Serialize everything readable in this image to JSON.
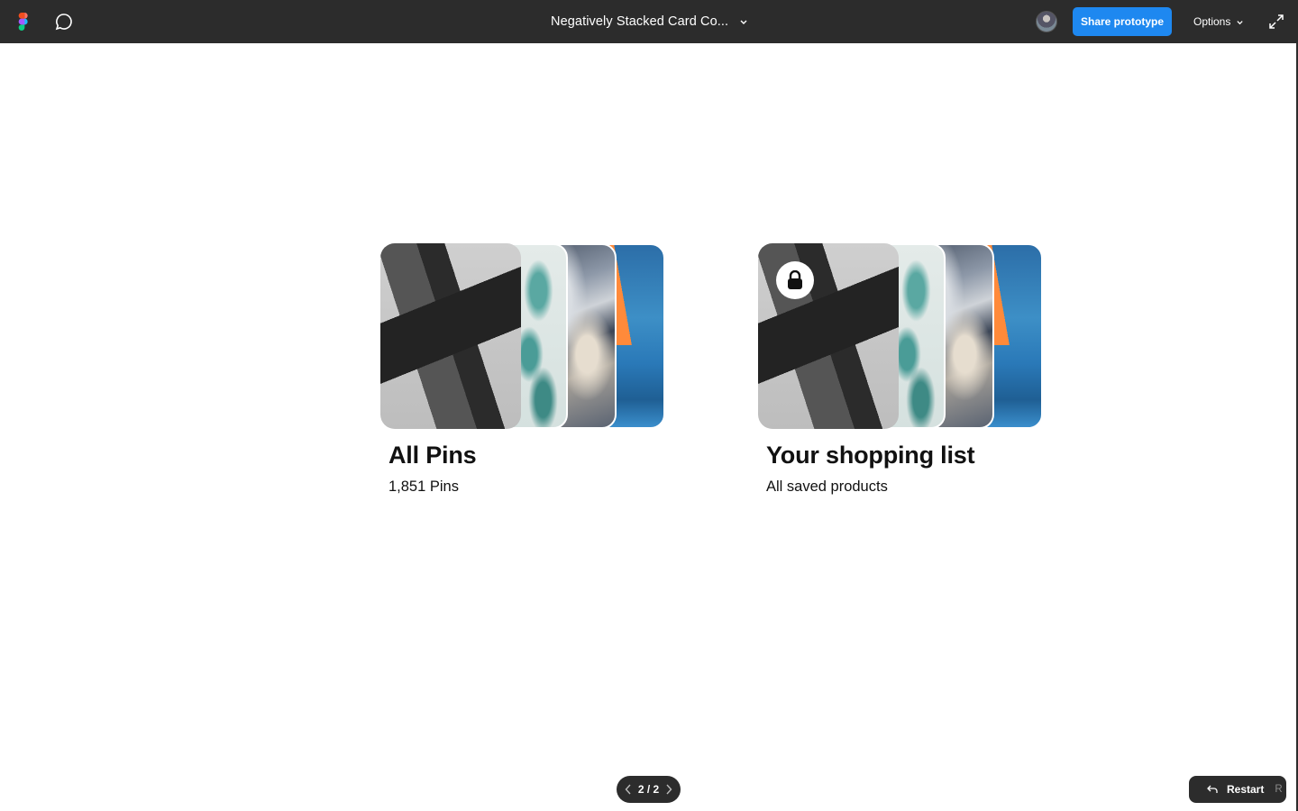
{
  "topbar": {
    "logo_icon": "figma-logo-icon",
    "comment_icon": "comment-icon",
    "file_title": "Negatively Stacked Card Co...",
    "share_label": "Share prototype",
    "options_label": "Options",
    "expand_icon": "expand-icon",
    "accent_color": "#1e88f0",
    "bar_color": "#2c2c2c"
  },
  "boards": [
    {
      "title": "All Pins",
      "subtitle": "1,851 Pins",
      "locked": false
    },
    {
      "title": "Your shopping list",
      "subtitle": "All saved products",
      "locked": true
    }
  ],
  "pager": {
    "label": "2 / 2"
  },
  "restart": {
    "label": "Restart",
    "shortcut": "R"
  }
}
